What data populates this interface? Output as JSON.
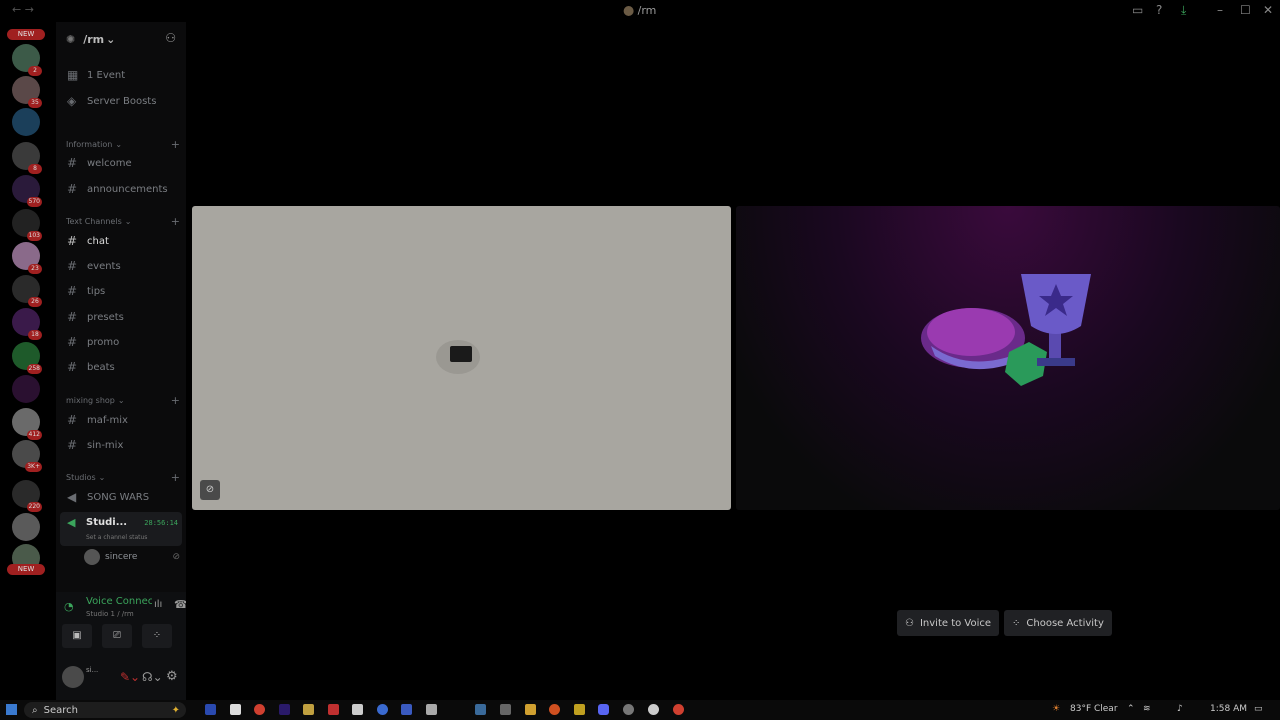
{
  "window": {
    "title": "/rm"
  },
  "server": {
    "name": "/rm"
  },
  "top_items": [
    {
      "label": "1 Event"
    },
    {
      "label": "Server Boosts"
    }
  ],
  "categories": {
    "information": "Information",
    "text_channels": "Text Channels",
    "mixing_shop": "mixing shop",
    "studios": "Studios"
  },
  "channels": {
    "welcome": "welcome",
    "announcements": "announcements",
    "chat": "chat",
    "events": "events",
    "tips": "tips",
    "presets": "presets",
    "promo": "promo",
    "beats": "beats",
    "maf_mix": "maf-mix",
    "sin_mix": "sin-mix",
    "song_wars": "SONG WARS",
    "studio1": "Studi...",
    "studio1_timer": "28:56:14",
    "studio1_status": "Set a channel status",
    "voice_member": "sincere"
  },
  "server_badges": [
    "NEW",
    "2",
    "35",
    "8",
    "570",
    "103",
    "23",
    "26",
    "18",
    "258",
    "412",
    "3K+",
    "220",
    "NEW"
  ],
  "voice": {
    "status": "Voice Connected",
    "location": "Studio 1 / /rm"
  },
  "user": {
    "name": "si..."
  },
  "actions": {
    "invite": "Invite to Voice",
    "choose_activity": "Choose Activity"
  },
  "taskbar": {
    "search_placeholder": "Search",
    "weather": "83°F  Clear",
    "time": "1:58 AM"
  },
  "colors": {
    "voice_green": "#3ba55c",
    "badge_red": "#a02020",
    "tile_grey": "#a8a6a0",
    "activity_purple": "#3a0a3c"
  }
}
